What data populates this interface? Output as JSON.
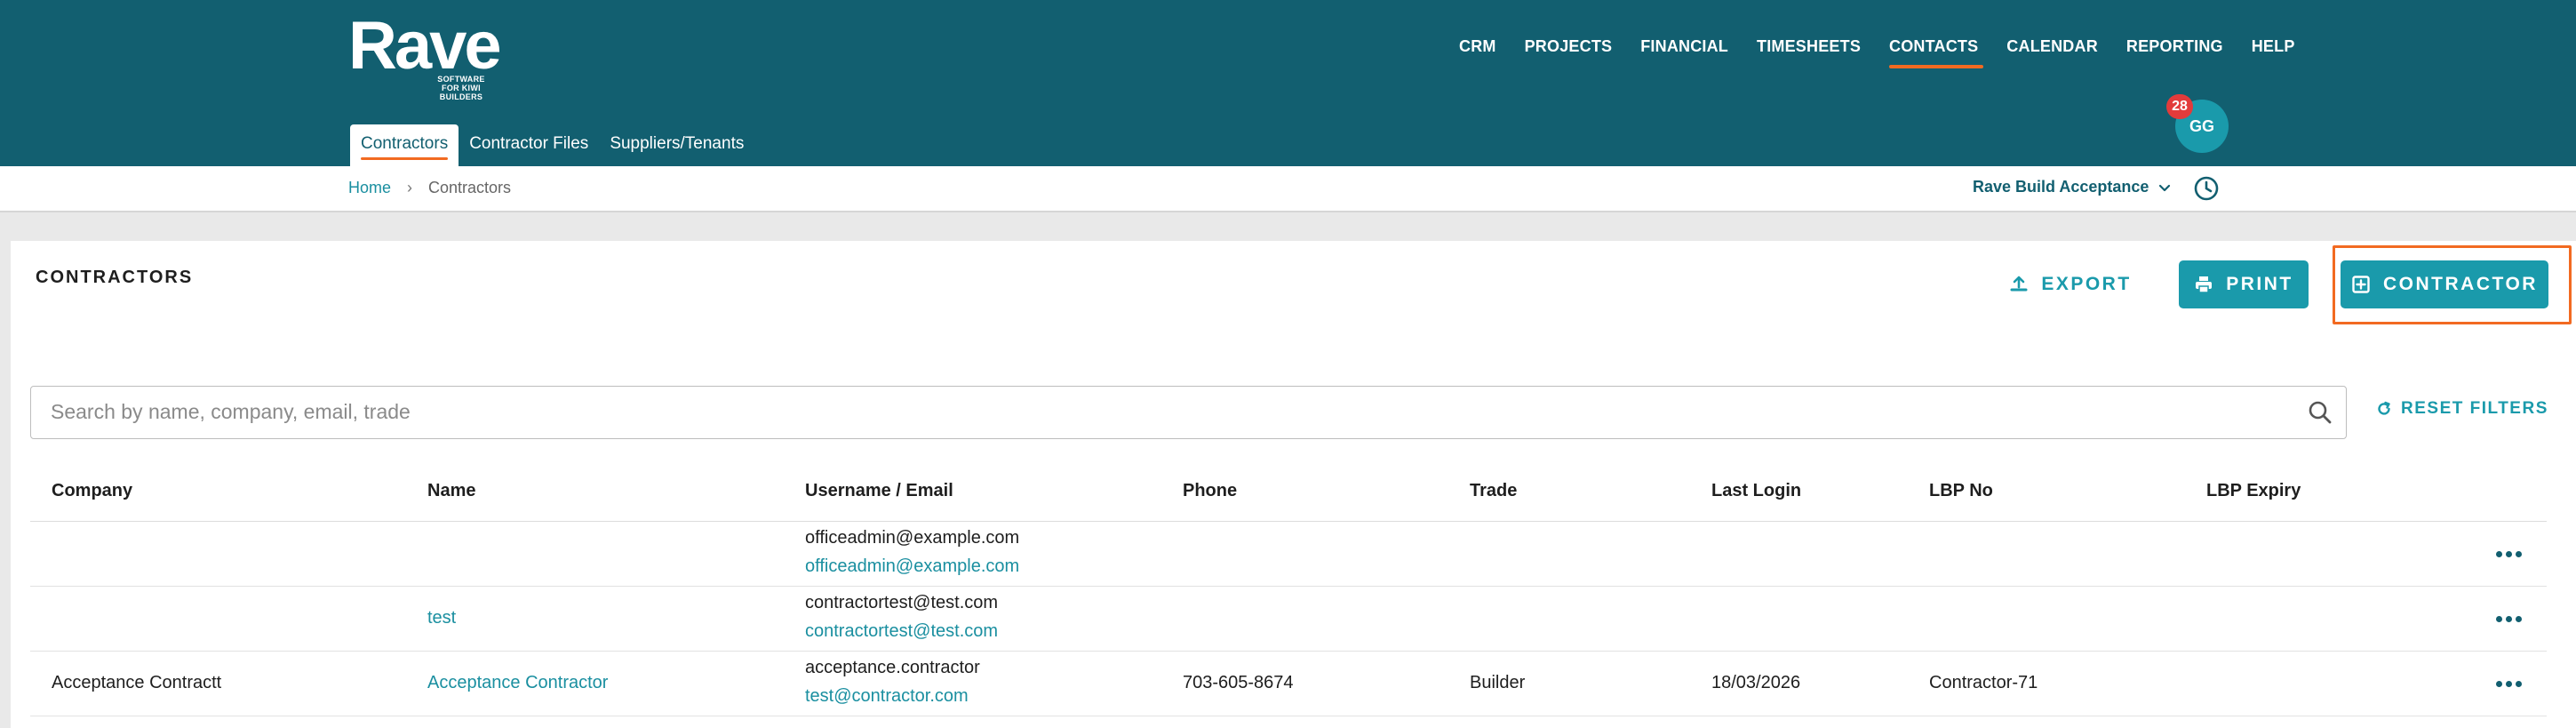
{
  "brand": {
    "name": "Rave",
    "tagline": "SOFTWARE FOR KIWI BUILDERS"
  },
  "main_nav": [
    {
      "label": "CRM",
      "active": false
    },
    {
      "label": "PROJECTS",
      "active": false
    },
    {
      "label": "FINANCIAL",
      "active": false
    },
    {
      "label": "TIMESHEETS",
      "active": false
    },
    {
      "label": "CONTACTS",
      "active": true
    },
    {
      "label": "CALENDAR",
      "active": false
    },
    {
      "label": "REPORTING",
      "active": false
    },
    {
      "label": "HELP",
      "active": false
    }
  ],
  "sub_tabs": [
    {
      "label": "Contractors",
      "active": true
    },
    {
      "label": "Contractor Files",
      "active": false
    },
    {
      "label": "Suppliers/Tenants",
      "active": false
    }
  ],
  "user": {
    "initials": "GG",
    "notification_count": "28"
  },
  "breadcrumb": {
    "home": "Home",
    "separator": "›",
    "current": "Contractors"
  },
  "project_selector": {
    "value": "Rave Build Acceptance"
  },
  "page": {
    "title": "CONTRACTORS",
    "export_label": "EXPORT",
    "print_label": "PRINT",
    "add_contractor_label": "CONTRACTOR",
    "search_placeholder": "Search by name, company, email, trade",
    "reset_filters_label": "RESET FILTERS"
  },
  "table": {
    "columns": [
      "Company",
      "Name",
      "Username / Email",
      "Phone",
      "Trade",
      "Last Login",
      "LBP No",
      "LBP Expiry"
    ],
    "rows": [
      {
        "company": "",
        "name": "",
        "username": "officeadmin@example.com",
        "email": "officeadmin@example.com",
        "phone": "",
        "trade": "",
        "last_login": "",
        "lbp_no": "",
        "lbp_expiry": ""
      },
      {
        "company": "",
        "name": "test",
        "username": "contractortest@test.com",
        "email": "contractortest@test.com",
        "phone": "",
        "trade": "",
        "last_login": "",
        "lbp_no": "",
        "lbp_expiry": ""
      },
      {
        "company": "Acceptance Contractt",
        "name": "Acceptance Contractor",
        "username": "acceptance.contractor",
        "email": "test@contractor.com",
        "phone": "703-605-8674",
        "trade": "Builder",
        "last_login": "18/03/2026",
        "lbp_no": "Contractor-71",
        "lbp_expiry": ""
      }
    ]
  },
  "colors": {
    "header_bg": "#125f70",
    "accent": "#1a9aab",
    "active_underline": "#f26a21",
    "badge": "#e23b3b",
    "highlight": "#f26a21"
  }
}
